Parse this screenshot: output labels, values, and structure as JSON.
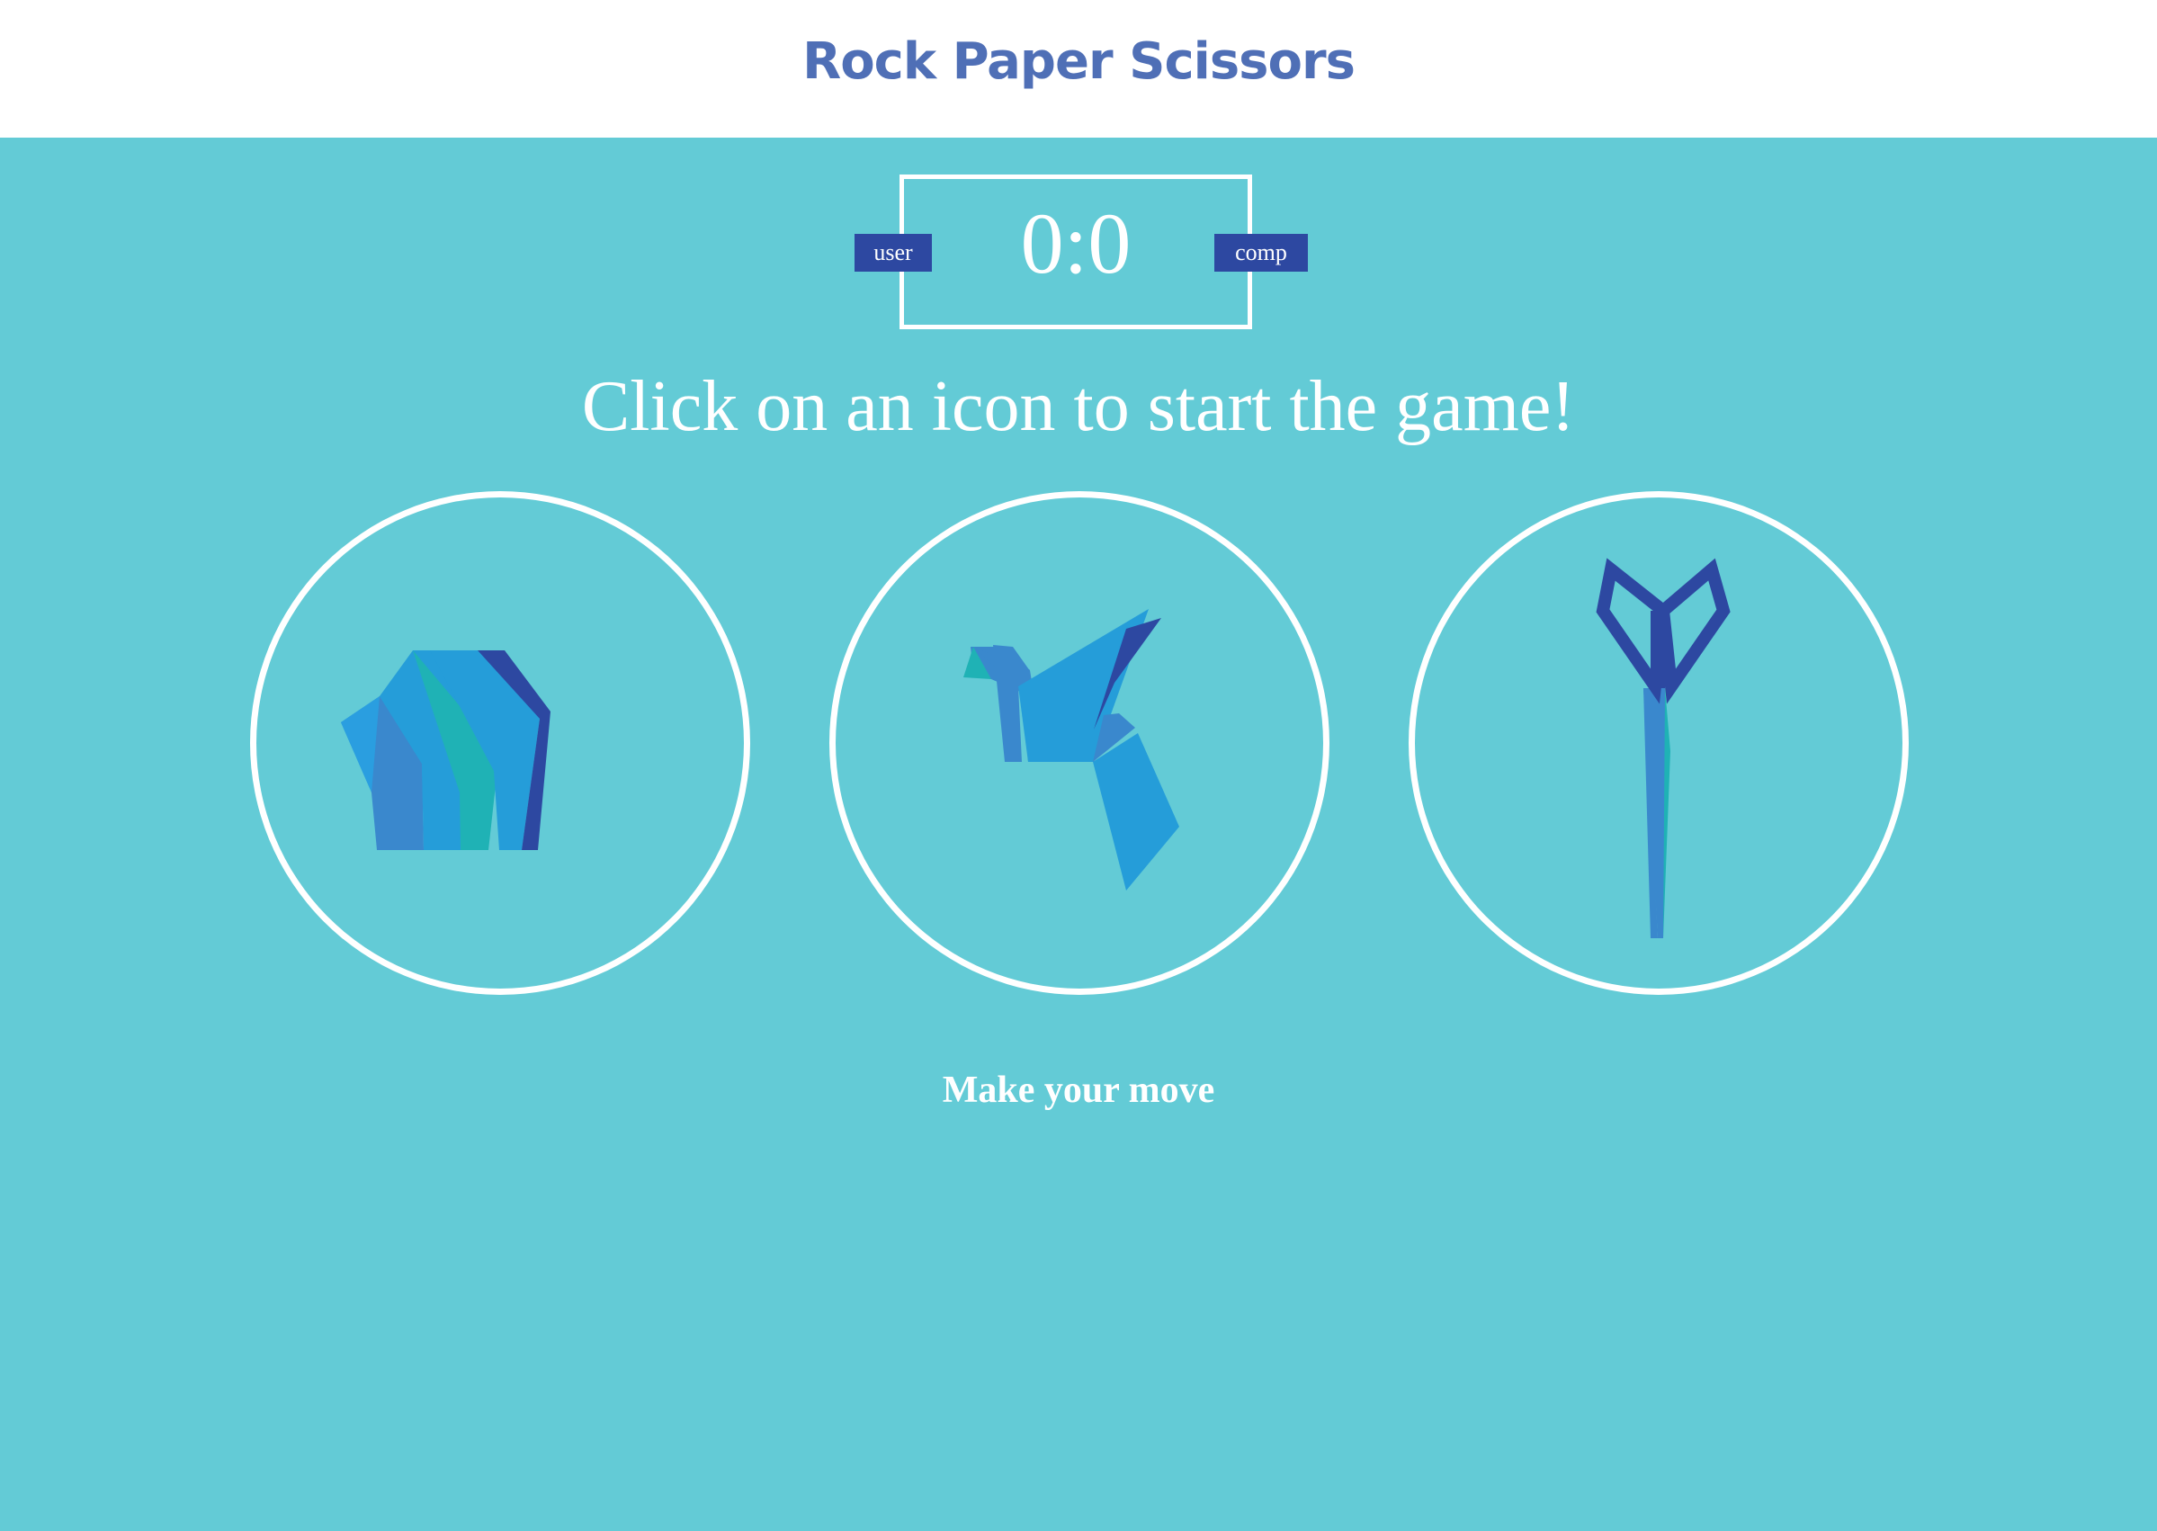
{
  "header": {
    "title": "Rock Paper Scissors"
  },
  "scoreboard": {
    "user_label": "user",
    "comp_label": "comp",
    "score": "0:0",
    "user_score": 0,
    "comp_score": 0
  },
  "instruction": "Click on an icon to start the game!",
  "choices": [
    {
      "id": "rock",
      "icon": "origami-rock-icon"
    },
    {
      "id": "paper",
      "icon": "origami-bird-icon"
    },
    {
      "id": "scissors",
      "icon": "origami-scissors-icon"
    }
  ],
  "action_message": "Make your move",
  "colors": {
    "background": "#63cbd6",
    "header_bg": "#ffffff",
    "title": "#4f6fb6",
    "badge": "#2d48a1",
    "icon_blue": "#259dd9",
    "icon_mid": "#3a88cd",
    "icon_teal": "#1fb2b5",
    "icon_dark": "#2d48a1"
  }
}
